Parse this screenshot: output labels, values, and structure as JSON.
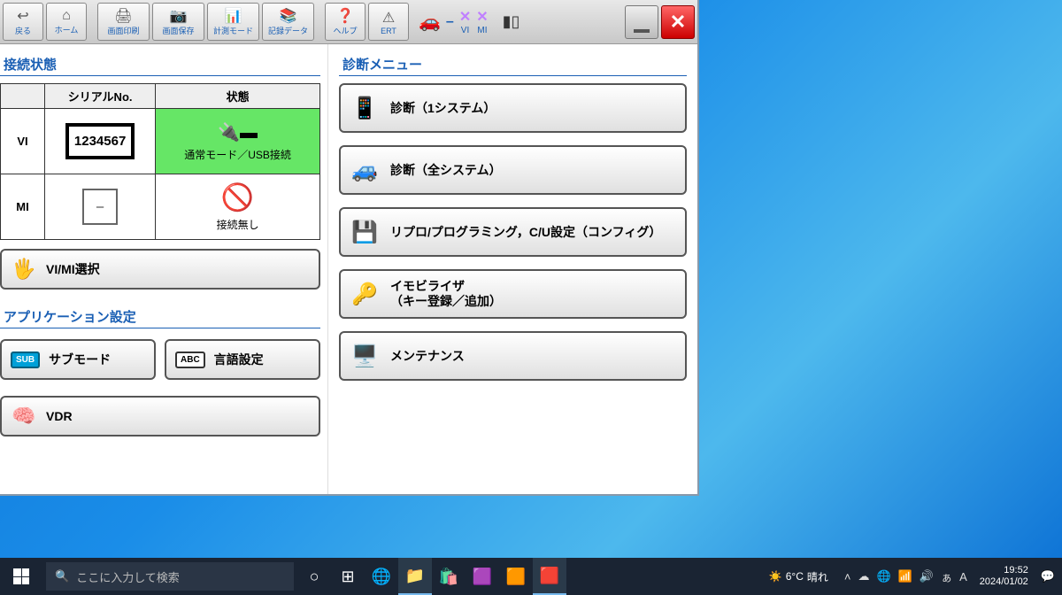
{
  "toolbar": {
    "back": "戻る",
    "home": "ホーム",
    "print": "画面印刷",
    "save": "画面保存",
    "measure": "計測モード",
    "record": "記録データ",
    "help": "ヘルプ",
    "ert": "ERT",
    "vi": "VI",
    "mi": "MI"
  },
  "connection": {
    "title": "接続状態",
    "col_serial": "シリアルNo.",
    "col_status": "状態",
    "vi": {
      "label": "VI",
      "serial": "1234567",
      "status": "通常モード／USB接続"
    },
    "mi": {
      "label": "MI",
      "serial": "–",
      "status": "接続無し"
    },
    "select_btn": "VI/MI選択"
  },
  "app_settings": {
    "title": "アプリケーション設定",
    "sub_mode": "サブモード",
    "sub_badge": "SUB",
    "lang": "言語設定",
    "lang_badge": "ABC",
    "vdr": "VDR"
  },
  "diag": {
    "title": "診断メニュー",
    "items": [
      "診断（1システム）",
      "診断（全システム）",
      "リプロ/プログラミング，C/U設定（コンフィグ）",
      "イモビライザ\n（キー登録／追加）",
      "メンテナンス"
    ]
  },
  "taskbar": {
    "search_placeholder": "ここに入力して検索",
    "weather_temp": "6°C",
    "weather_text": "晴れ",
    "ime": "A",
    "time": "19:52",
    "date": "2024/01/02"
  }
}
